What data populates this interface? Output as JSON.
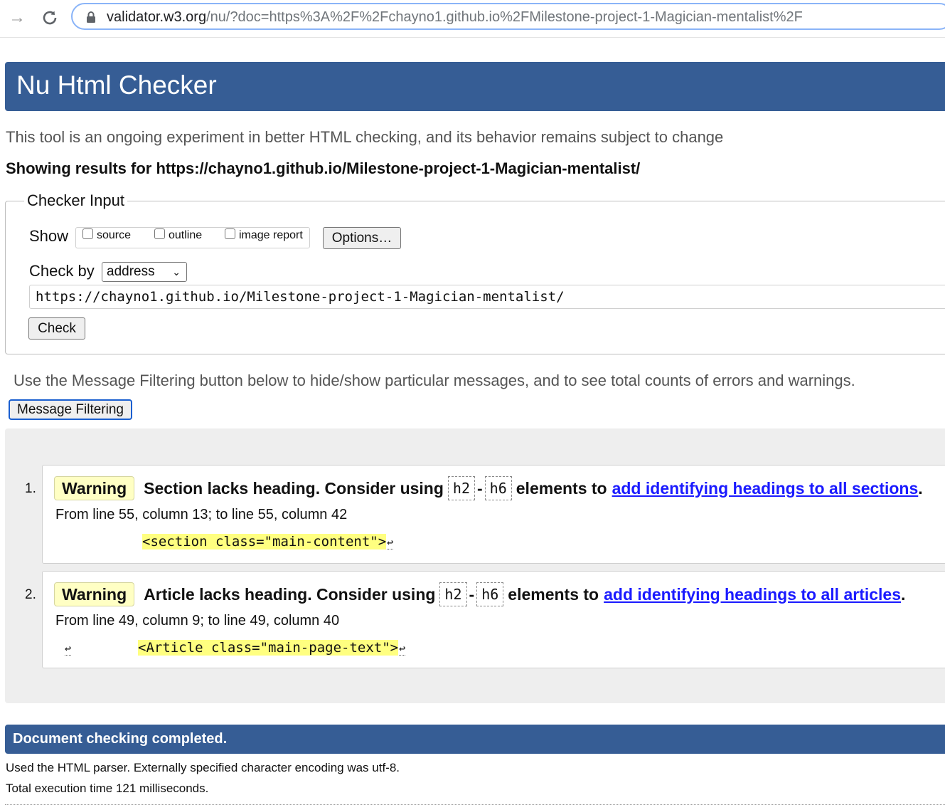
{
  "browser": {
    "url_host": "validator.w3.org",
    "url_rest": "/nu/?doc=https%3A%2F%2Fchayno1.github.io%2FMilestone-project-1-Magician-mentalist%2F"
  },
  "header": {
    "title": "Nu Html Checker"
  },
  "intro": "This tool is an ongoing experiment in better HTML checking, and its behavior remains subject to change",
  "results_heading": "Showing results for https://chayno1.github.io/Milestone-project-1-Magician-mentalist/",
  "checker_input": {
    "legend": "Checker Input",
    "show_label": "Show",
    "show_options": [
      {
        "label": "source",
        "checked": false
      },
      {
        "label": "outline",
        "checked": false
      },
      {
        "label": "image report",
        "checked": false
      }
    ],
    "options_button": "Options…",
    "check_by_label": "Check by",
    "check_by_value": "address",
    "url_value": "https://chayno1.github.io/Milestone-project-1-Magician-mentalist/",
    "check_button": "Check"
  },
  "filter_hint": "Use the Message Filtering button below to hide/show particular messages, and to see total counts of errors and warnings.",
  "message_filtering_button": "Message Filtering",
  "messages": [
    {
      "number": "1.",
      "type": "Warning",
      "text_before": "Section lacks heading. Consider using",
      "code_from": "h2",
      "dash": "-",
      "code_to": "h6",
      "text_middle": "elements to",
      "link": "add identifying headings to all sections",
      "text_end": ".",
      "location": "From line 55, column 13; to line 55, column 42",
      "extract_prefix": "",
      "extract": "<section class=\"main-content\">",
      "extract_return": "↩"
    },
    {
      "number": "2.",
      "type": "Warning",
      "text_before": "Article lacks heading. Consider using",
      "code_from": "h2",
      "dash": "-",
      "code_to": "h6",
      "text_middle": "elements to",
      "link": "add identifying headings to all articles",
      "text_end": ".",
      "location": "From line 49, column 9; to line 49, column 40",
      "extract_prefix": "↩",
      "extract": "<Article class=\"main-page-text\">",
      "extract_return": "↩"
    }
  ],
  "completion": {
    "banner": "Document checking completed.",
    "parser_note": "Used the HTML parser. Externally specified character encoding was utf-8.",
    "exec_time": "Total execution time 121 milliseconds."
  },
  "colors": {
    "banner": "#365d95",
    "warning_badge": "#ffffc4",
    "highlight": "#ffff80",
    "link": "#1a1aff"
  }
}
